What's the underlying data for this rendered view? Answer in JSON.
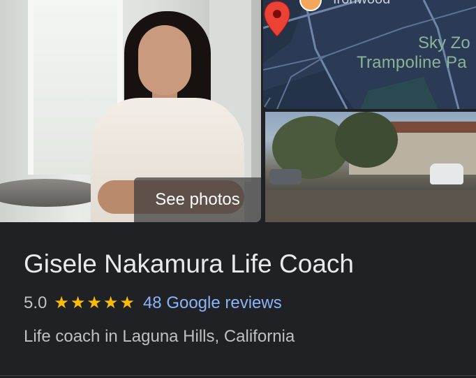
{
  "photos": {
    "see_photos_label": "See photos",
    "map": {
      "street_label": "Ironwood",
      "place_label_top": "Sky Zo",
      "place_label": "Trampoline Pa"
    }
  },
  "business": {
    "name": "Gisele Nakamura Life Coach",
    "rating": "5.0",
    "stars": 5,
    "reviews_label": "48 Google reviews",
    "category": "Life coach in Laguna Hills, California"
  },
  "colors": {
    "background": "#202124",
    "star": "#fbbc04",
    "link": "#8ab4f8",
    "map_label": "#8bb397",
    "pin": "#ea4335"
  }
}
